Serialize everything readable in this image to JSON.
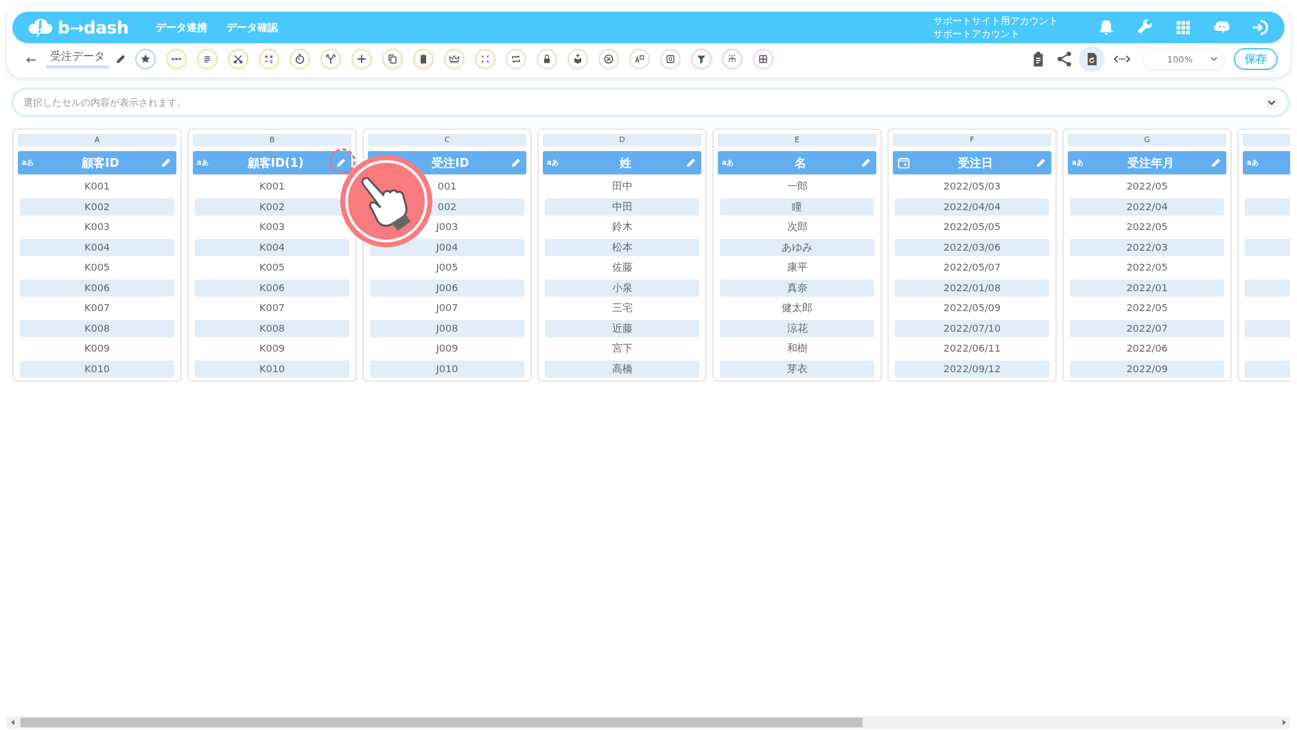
{
  "header": {
    "logo_text": "b→dash",
    "nav": [
      "データ連携",
      "データ確認"
    ],
    "account": [
      "サポートサイト用アカウント",
      "サポートアカウント"
    ]
  },
  "toolbar": {
    "back": "←",
    "title": "受注データ",
    "zoom": "100%",
    "save": "保存"
  },
  "cell_bar": {
    "placeholder": "選択したセルの内容が表示されます。"
  },
  "columns": [
    {
      "letter": "A",
      "name": "顧客ID",
      "kind": "text",
      "type_label": "aあ",
      "highlighted": false,
      "rows": [
        "K001",
        "K002",
        "K003",
        "K004",
        "K005",
        "K006",
        "K007",
        "K008",
        "K009",
        "K010"
      ]
    },
    {
      "letter": "B",
      "name": "顧客ID(1)",
      "kind": "text",
      "type_label": "aあ",
      "highlighted": true,
      "rows": [
        "K001",
        "K002",
        "K003",
        "K004",
        "K005",
        "K006",
        "K007",
        "K008",
        "K009",
        "K010"
      ]
    },
    {
      "letter": "C",
      "name": "受注ID",
      "kind": "text",
      "highlighted": false,
      "rows": [
        "001",
        "002",
        "J003",
        "J004",
        "J005",
        "J006",
        "J007",
        "J008",
        "J009",
        "J010"
      ]
    },
    {
      "letter": "D",
      "name": "姓",
      "kind": "text",
      "type_label": "aあ",
      "highlighted": false,
      "rows": [
        "田中",
        "中田",
        "鈴木",
        "松本",
        "佐藤",
        "小泉",
        "三宅",
        "近藤",
        "宮下",
        "高橋"
      ]
    },
    {
      "letter": "E",
      "name": "名",
      "kind": "text",
      "type_label": "aあ",
      "highlighted": false,
      "rows": [
        "一郎",
        "瞳",
        "次郎",
        "あゆみ",
        "康平",
        "真奈",
        "健太郎",
        "涼花",
        "和樹",
        "芽衣"
      ]
    },
    {
      "letter": "F",
      "name": "受注日",
      "kind": "date",
      "highlighted": false,
      "rows": [
        "2022/05/03",
        "2022/04/04",
        "2022/05/05",
        "2022/03/06",
        "2022/05/07",
        "2022/01/08",
        "2022/05/09",
        "2022/07/10",
        "2022/06/11",
        "2022/09/12"
      ]
    },
    {
      "letter": "G",
      "name": "受注年月",
      "kind": "text",
      "type_label": "aあ",
      "highlighted": false,
      "rows": [
        "2022/05",
        "2022/04",
        "2022/05",
        "2022/03",
        "2022/05",
        "2022/01",
        "2022/05",
        "2022/07",
        "2022/06",
        "2022/09"
      ]
    },
    {
      "kind": "text",
      "type_label": "aあ",
      "highlighted": false
    }
  ]
}
